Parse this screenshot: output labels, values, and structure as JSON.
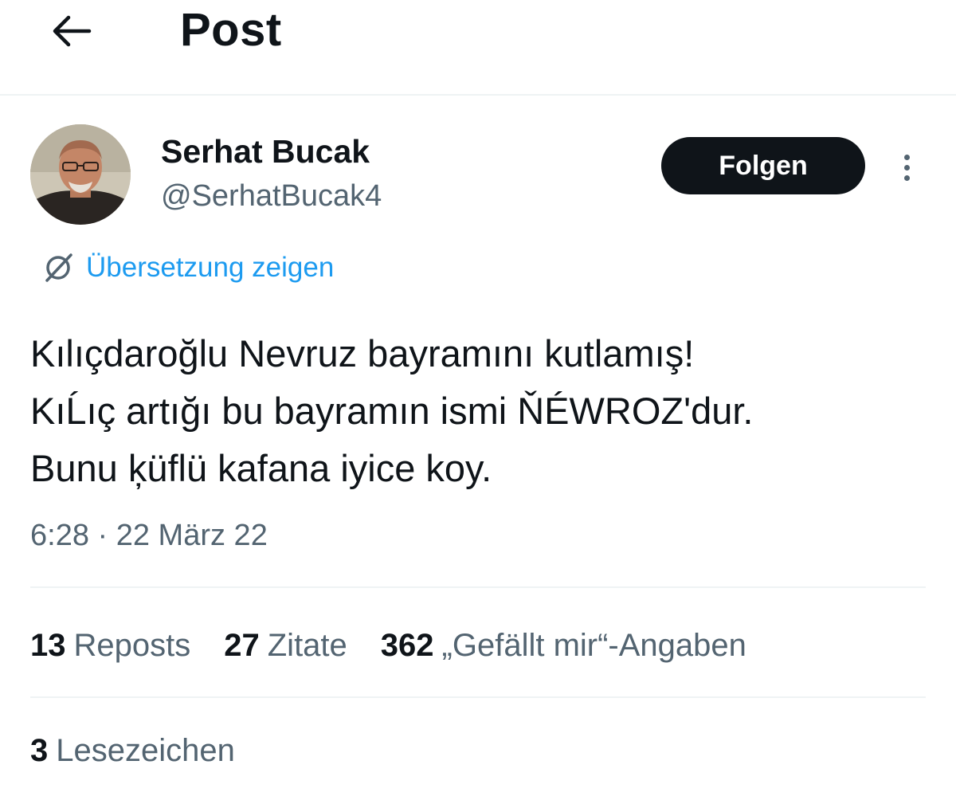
{
  "header": {
    "back_icon": "arrow-left-icon",
    "title": "Post"
  },
  "author": {
    "display_name": "Serhat Bucak",
    "handle": "@SerhatBucak4",
    "follow_label": "Folgen",
    "more_icon": "more-vertical-icon"
  },
  "translate": {
    "icon": "globe-translate-icon",
    "label": "Übersetzung zeigen"
  },
  "post": {
    "lines": [
      "Kılıçdaroğlu Nevruz bayramını kutlamış!",
      "KıĹıç artığı bu bayramın ismi ŇÉWROZ'dur.",
      "Bunu ķüflü kafana iyice koy."
    ],
    "timestamp": "6:28 · 22 März 22"
  },
  "stats": {
    "reposts_count": "13",
    "reposts_label": "Reposts",
    "quotes_count": "27",
    "quotes_label": "Zitate",
    "likes_count": "362",
    "likes_label": "„Gefällt mir“-Angaben",
    "bookmarks_count": "3",
    "bookmarks_label": "Lesezeichen"
  },
  "colors": {
    "text_primary": "#0f1419",
    "text_secondary": "#536471",
    "link_blue": "#1d9bf0",
    "divider": "#eff3f4",
    "follow_button_bg": "#0f1419"
  }
}
